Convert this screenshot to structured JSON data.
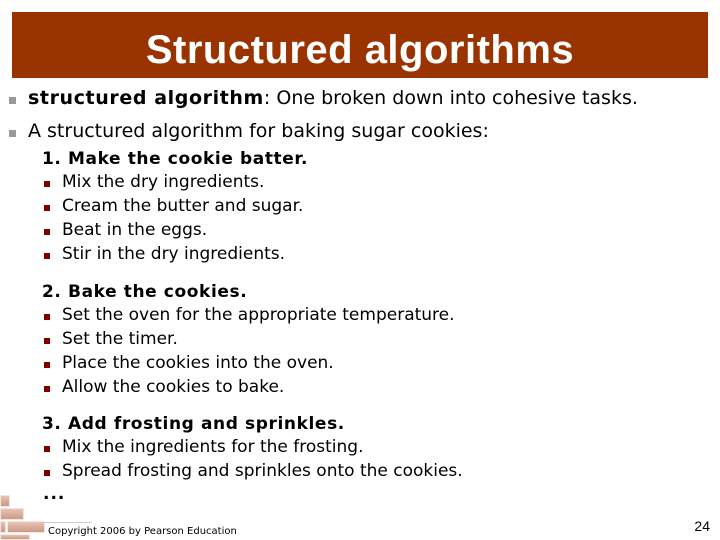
{
  "slide": {
    "title": "Structured algorithms",
    "bullets": [
      {
        "term": "structured algorithm",
        "text": ": One broken down into cohesive tasks."
      },
      {
        "term": "",
        "text": "A structured algorithm for baking sugar cookies:"
      }
    ],
    "steps": [
      {
        "heading": "1. Make the cookie batter.",
        "items": [
          "Mix the dry ingredients.",
          "Cream the butter and sugar.",
          "Beat in the eggs.",
          "Stir in the dry ingredients."
        ]
      },
      {
        "heading": "2. Bake the cookies.",
        "items": [
          "Set the oven for the appropriate temperature.",
          "Set the timer.",
          "Place the cookies into the oven.",
          "Allow the cookies to bake."
        ]
      },
      {
        "heading": "3. Add frosting and sprinkles.",
        "items": [
          "Mix the ingredients for the frosting.",
          "Spread frosting and sprinkles onto the cookies."
        ]
      }
    ],
    "ellipsis": "...",
    "copyright": "Copyright 2006 by Pearson Education",
    "page_number": "24"
  },
  "colors": {
    "title_bar": "#993300",
    "top_bullet": "#999999",
    "sub_bullet": "#800000"
  }
}
